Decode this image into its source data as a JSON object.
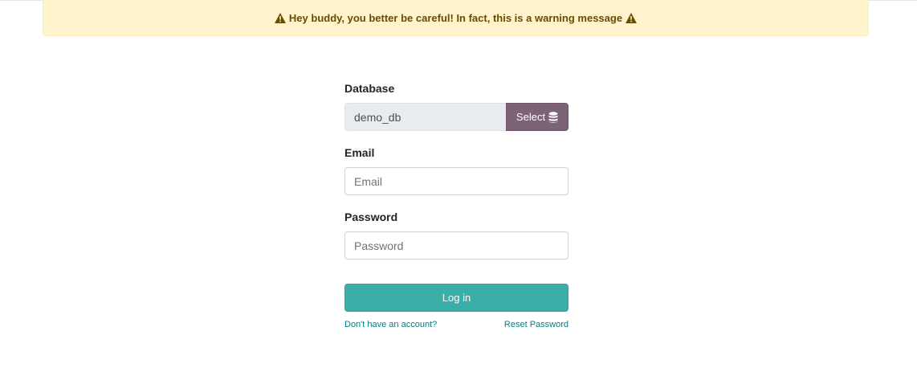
{
  "warning": {
    "message": "Hey buddy, you better be careful! In fact, this is a warning message",
    "icon": "warning-triangle-icon"
  },
  "login": {
    "database_label": "Database",
    "database_value": "demo_db",
    "select_label": "Select",
    "select_icon": "database-icon",
    "email_label": "Email",
    "email_placeholder": "Email",
    "email_value": "",
    "password_label": "Password",
    "password_placeholder": "Password",
    "password_value": "",
    "login_button": "Log in",
    "signup_link": "Don't have an account?",
    "reset_link": "Reset Password"
  },
  "colors": {
    "warning_bg": "#fff3cd",
    "warning_text": "#664d03",
    "select_button": "#7b6275",
    "login_button": "#3aaea9",
    "link": "#017e84"
  }
}
